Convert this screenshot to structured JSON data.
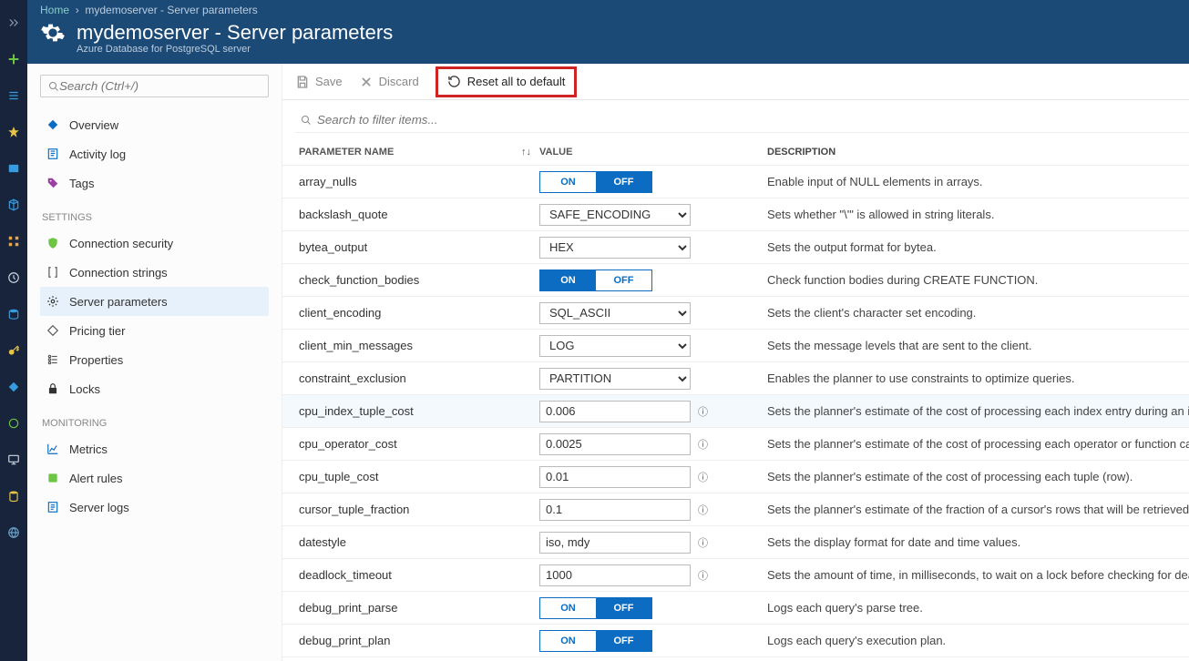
{
  "breadcrumb": {
    "home": "Home",
    "page": "mydemoserver - Server parameters"
  },
  "header": {
    "title": "mydemoserver - Server parameters",
    "subtitle": "Azure Database for PostgreSQL server"
  },
  "sidebar": {
    "search_placeholder": "Search (Ctrl+/)",
    "groups": [
      {
        "label": "",
        "items": [
          {
            "label": "Overview"
          },
          {
            "label": "Activity log"
          },
          {
            "label": "Tags"
          }
        ]
      },
      {
        "label": "SETTINGS",
        "items": [
          {
            "label": "Connection security"
          },
          {
            "label": "Connection strings"
          },
          {
            "label": "Server parameters",
            "selected": true
          },
          {
            "label": "Pricing tier"
          },
          {
            "label": "Properties"
          },
          {
            "label": "Locks"
          }
        ]
      },
      {
        "label": "MONITORING",
        "items": [
          {
            "label": "Metrics"
          },
          {
            "label": "Alert rules"
          },
          {
            "label": "Server logs"
          }
        ]
      }
    ]
  },
  "toolbar": {
    "save": "Save",
    "discard": "Discard",
    "reset": "Reset all to default"
  },
  "filter_placeholder": "Search to filter items...",
  "columns": {
    "name": "PARAMETER NAME",
    "value": "VALUE",
    "desc": "DESCRIPTION",
    "sort": "↑↓"
  },
  "toggle_labels": {
    "on": "ON",
    "off": "OFF"
  },
  "params": [
    {
      "name": "array_nulls",
      "type": "toggle",
      "value": "OFF",
      "desc": "Enable input of NULL elements in arrays."
    },
    {
      "name": "backslash_quote",
      "type": "select",
      "value": "SAFE_ENCODING",
      "desc": "Sets whether \"\\'\" is allowed in string literals."
    },
    {
      "name": "bytea_output",
      "type": "select",
      "value": "HEX",
      "desc": "Sets the output format for bytea."
    },
    {
      "name": "check_function_bodies",
      "type": "toggle",
      "value": "ON",
      "desc": "Check function bodies during CREATE FUNCTION."
    },
    {
      "name": "client_encoding",
      "type": "select",
      "value": "SQL_ASCII",
      "desc": "Sets the client's character set encoding."
    },
    {
      "name": "client_min_messages",
      "type": "select",
      "value": "LOG",
      "desc": "Sets the message levels that are sent to the client."
    },
    {
      "name": "constraint_exclusion",
      "type": "select",
      "value": "PARTITION",
      "desc": "Enables the planner to use constraints to optimize queries."
    },
    {
      "name": "cpu_index_tuple_cost",
      "type": "text",
      "value": "0.006",
      "info": true,
      "hover": true,
      "desc": "Sets the planner's estimate of the cost of processing each index entry during an in"
    },
    {
      "name": "cpu_operator_cost",
      "type": "text",
      "value": "0.0025",
      "info": true,
      "desc": "Sets the planner's estimate of the cost of processing each operator or function cal"
    },
    {
      "name": "cpu_tuple_cost",
      "type": "text",
      "value": "0.01",
      "info": true,
      "desc": "Sets the planner's estimate of the cost of processing each tuple (row)."
    },
    {
      "name": "cursor_tuple_fraction",
      "type": "text",
      "value": "0.1",
      "info": true,
      "desc": "Sets the planner's estimate of the fraction of a cursor's rows that will be retrieved."
    },
    {
      "name": "datestyle",
      "type": "text",
      "value": "iso, mdy",
      "info": true,
      "desc": "Sets the display format for date and time values."
    },
    {
      "name": "deadlock_timeout",
      "type": "text",
      "value": "1000",
      "info": true,
      "desc": "Sets the amount of time, in milliseconds, to wait on a lock before checking for dea"
    },
    {
      "name": "debug_print_parse",
      "type": "toggle",
      "value": "OFF",
      "desc": "Logs each query's parse tree."
    },
    {
      "name": "debug_print_plan",
      "type": "toggle",
      "value": "OFF",
      "desc": "Logs each query's execution plan."
    }
  ],
  "rail_icons": [
    "chevrons",
    "plus",
    "list",
    "star",
    "dashboard",
    "cube",
    "grid",
    "clock",
    "sql",
    "key",
    "diamond",
    "circle",
    "monitor",
    "db",
    "globe"
  ]
}
